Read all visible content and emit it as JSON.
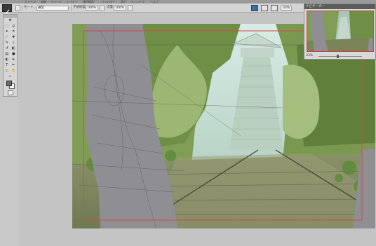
{
  "menubar": {
    "items": [
      "ファイル",
      "編集",
      "イメージ",
      "レイヤー",
      "選択範囲",
      "フィルター",
      "表示",
      "ウィンドウ",
      "ヘルプ"
    ]
  },
  "options_bar": {
    "mode_label": "モード:",
    "mode_value": "通常",
    "opacity_label": "不透明度:",
    "opacity_value": "100%",
    "flow_label": "流量:",
    "flow_value": "100%"
  },
  "right_bar": {
    "zoom_value": "33%"
  },
  "navigator": {
    "title": "ナビゲーター",
    "zoom_value": "33%"
  },
  "toolbox": {
    "tools": [
      "move-tool",
      "marquee-tool",
      "lasso-tool",
      "magic-wand-tool",
      "crop-tool",
      "eyedropper-tool",
      "healing-tool",
      "brush-tool",
      "stamp-tool",
      "history-brush-tool",
      "eraser-tool",
      "gradient-tool",
      "blur-tool",
      "dodge-tool",
      "path-select-tool",
      "type-tool",
      "pen-tool",
      "shape-tool",
      "hand-tool",
      "zoom-tool"
    ]
  },
  "colors": {
    "foreground": "#6b6b6b",
    "background": "#ffffff",
    "guide": "#d24a44"
  }
}
